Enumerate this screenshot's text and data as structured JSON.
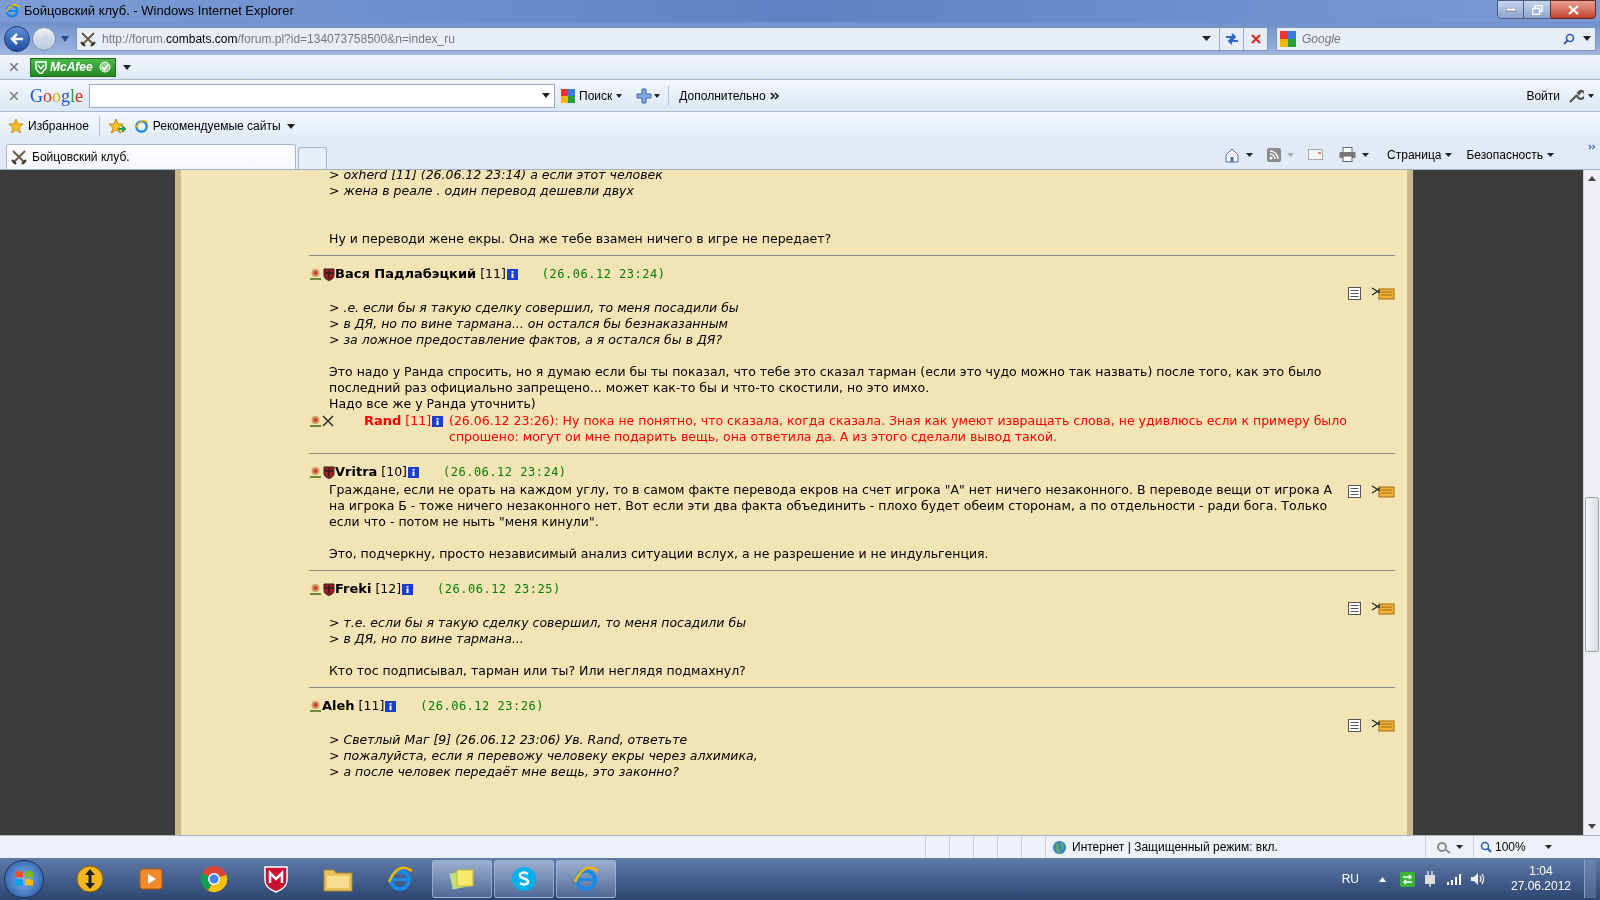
{
  "window": {
    "title": "Бойцовский клуб. - Windows Internet Explorer"
  },
  "address_bar": {
    "url": "http://forum.**combats.com**/forum.pl?id=134073758500&n=index_ru"
  },
  "search_box": {
    "placeholder": "Google"
  },
  "mcafee_toolbar": {
    "label": "McAfee"
  },
  "google_toolbar": {
    "logo": "Google",
    "search_button": "Поиск",
    "more": "Дополнительно",
    "sign_in": "Войти"
  },
  "favorites_bar": {
    "favorites": "Избранное",
    "suggested_sites": "Рекомендуемые сайты"
  },
  "tabs": [
    {
      "label": "Бойцовский клуб.",
      "selected": true
    }
  ],
  "command_bar": {
    "menus": [
      "Страница",
      "Безопасность"
    ]
  },
  "forum": {
    "continuation": {
      "quotes": [
        "> oxherd [11] (26.06.12 23:14) а если этот человек",
        "> жена в реале . один перевод дешевли двух"
      ],
      "body": [
        "Ну и переводи жене екры. Она же тебе взамен ничего в игре не передает?"
      ]
    },
    "posts": [
      {
        "author": "Вася Падлабэцкий",
        "level": "[11]",
        "time": "(26.06.12 23:24)",
        "clan_emblem": true,
        "quotes": [
          "> .е. если бы я такую сделку совершил, то меня посадили бы",
          "> в ДЯ, но по вине тармана... он остался бы безнаказанным",
          "> за ложное предоставление фактов, а я остался бы в ДЯ?"
        ],
        "body": [
          "Это надо у Ранда спросить, но я думаю если бы ты показал, что тебе это сказал тарман (если это чудо можно так назвать) после того, как это было последний раз официально запрещено... может как-то бы и что-то скостили, но это имхо.\nНадо все же у Ранда уточнить)"
        ],
        "reply": {
          "author": "Rand",
          "level": "[11]",
          "text": "(26.06.12 23:26): Ну пока не понятно, что сказала, когда сказала. Зная как умеют извращать слова, не удивлюсь если к примеру было спрошено: могут ои мне подарить вещь, она ответила да. А из этого сделали вывод такой."
        }
      },
      {
        "author": "Vritra",
        "level": "[10]",
        "time": "(26.06.12 23:24)",
        "clan_emblem": true,
        "body": [
          "Граждане, если не орать на каждом углу, то в самом факте перевода екров на счет игрока \"А\" нет ничего незаконного. В переводе вещи от игрока А на игрока Б - тоже ничего незаконного нет. Вот если эти два факта объединить - плохо будет обеим сторонам, а по отдельности - ради бога. Только если что - потом не ныть \"меня кинули\".",
          "Это, подчеркну, просто независимый анализ ситуации вслух, а не разрешение и не индульгенция."
        ]
      },
      {
        "author": "Freki",
        "level": "[12]",
        "time": "(26.06.12 23:25)",
        "clan_emblem": true,
        "quotes": [
          "> т.е. если бы я такую сделку совершил, то меня посадили бы",
          "> в ДЯ, но по вине тармана..."
        ],
        "body": [
          "Кто тос подписывал, тарман или ты? Или неглядя подмахнул?"
        ]
      },
      {
        "author": "Aleh",
        "level": "[11]",
        "time": "(26.06.12 23:26)",
        "clan_emblem": false,
        "quotes": [
          "> Светлый Маг [9] (26.06.12 23:06) Ув. Rand, ответьте",
          "> пожалуйста, если я перевожу человеку екры через алхимика,",
          "> а после человек передаёт мне вещь, это законно?"
        ]
      }
    ]
  },
  "status_bar": {
    "zone": "Интернет | Защищенный режим: вкл.",
    "zoom": "100%"
  },
  "taskbar": {
    "apps": [
      {
        "kind": "arrows",
        "running": false
      },
      {
        "kind": "media",
        "running": false
      },
      {
        "kind": "chrome",
        "running": false
      },
      {
        "kind": "shield",
        "running": false
      },
      {
        "kind": "folder",
        "running": false
      },
      {
        "kind": "ie",
        "running": false
      },
      {
        "kind": "notes",
        "running": true
      },
      {
        "kind": "skype",
        "running": true
      },
      {
        "kind": "ie",
        "running": true
      }
    ],
    "language": "RU",
    "time": "1:04",
    "date": "27.06.2012"
  }
}
